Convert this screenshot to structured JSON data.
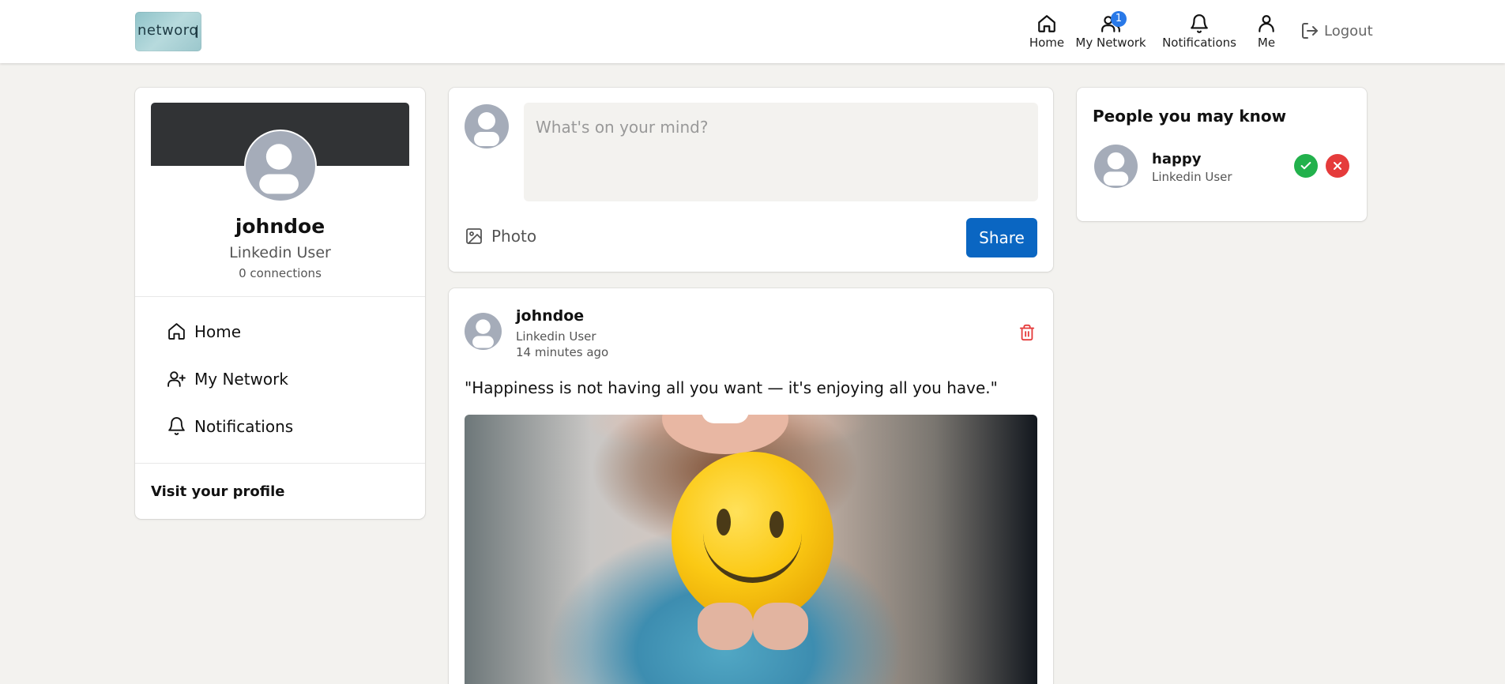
{
  "header": {
    "logo_text": "networq",
    "nav": {
      "home": "Home",
      "network": "My Network",
      "network_badge": "1",
      "notifications": "Notifications",
      "me": "Me"
    },
    "logout": "Logout"
  },
  "profile_card": {
    "username": "johndoe",
    "subtitle": "Linkedin User",
    "connections": "0 connections",
    "menu": [
      "Home",
      "My Network",
      "Notifications"
    ],
    "visit_profile": "Visit your profile"
  },
  "composer": {
    "placeholder": "What's on your mind?",
    "photo_label": "Photo",
    "share_label": "Share"
  },
  "post": {
    "author": "johndoe",
    "subtitle": "Linkedin User",
    "time": "14 minutes ago",
    "text": "\"Happiness is not having all you want — it's enjoying all you have.\""
  },
  "people_you_may_know": {
    "title": "People you may know",
    "person": {
      "name": "happy",
      "subtitle": "Linkedin User"
    }
  },
  "colors": {
    "primary": "#0a66c2",
    "badge": "#2979e8",
    "accept": "#22b14c",
    "reject": "#e53b3b",
    "delete": "#e53b3b",
    "cover": "#313335",
    "avatar": "#a5acb9"
  },
  "icons": [
    "home-icon",
    "network-icon",
    "bell-icon",
    "user-icon",
    "logout-icon",
    "add-user-icon",
    "image-icon",
    "trash-icon",
    "check-icon",
    "close-icon"
  ]
}
